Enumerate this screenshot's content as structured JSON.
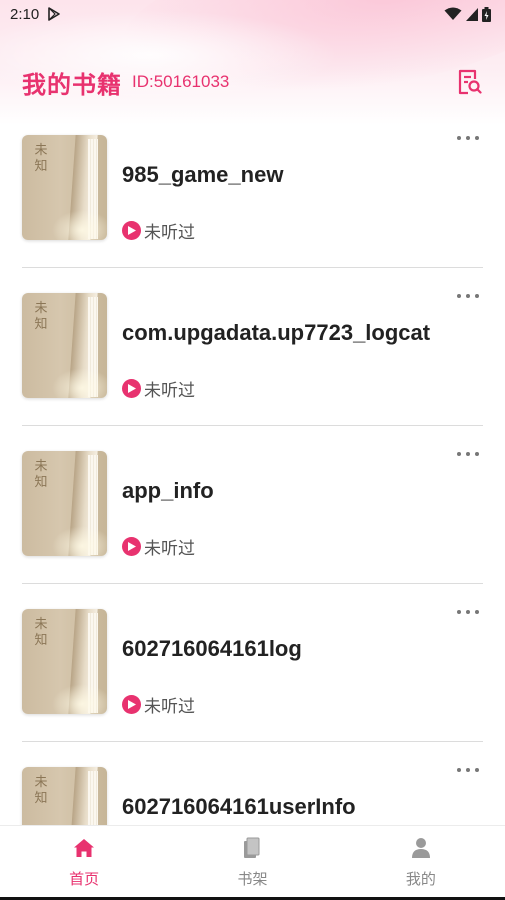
{
  "status_bar": {
    "time": "2:10"
  },
  "header": {
    "title": "我的书籍",
    "user_id": "ID:50161033"
  },
  "books": [
    {
      "cover_label": "未知",
      "title": "985_game_new",
      "status": "未听过"
    },
    {
      "cover_label": "未知",
      "title": "com.upgadata.up7723_logcat",
      "status": "未听过"
    },
    {
      "cover_label": "未知",
      "title": "app_info",
      "status": "未听过"
    },
    {
      "cover_label": "未知",
      "title": "602716064161log",
      "status": "未听过"
    },
    {
      "cover_label": "未知",
      "title": "602716064161userInfo",
      "status": ""
    }
  ],
  "nav": [
    {
      "label": "首页",
      "icon": "home-icon",
      "active": true
    },
    {
      "label": "书架",
      "icon": "bookshelf-icon",
      "active": false
    },
    {
      "label": "我的",
      "icon": "profile-icon",
      "active": false
    }
  ],
  "colors": {
    "accent": "#e8326f",
    "text": "#222222",
    "muted": "#888888"
  }
}
